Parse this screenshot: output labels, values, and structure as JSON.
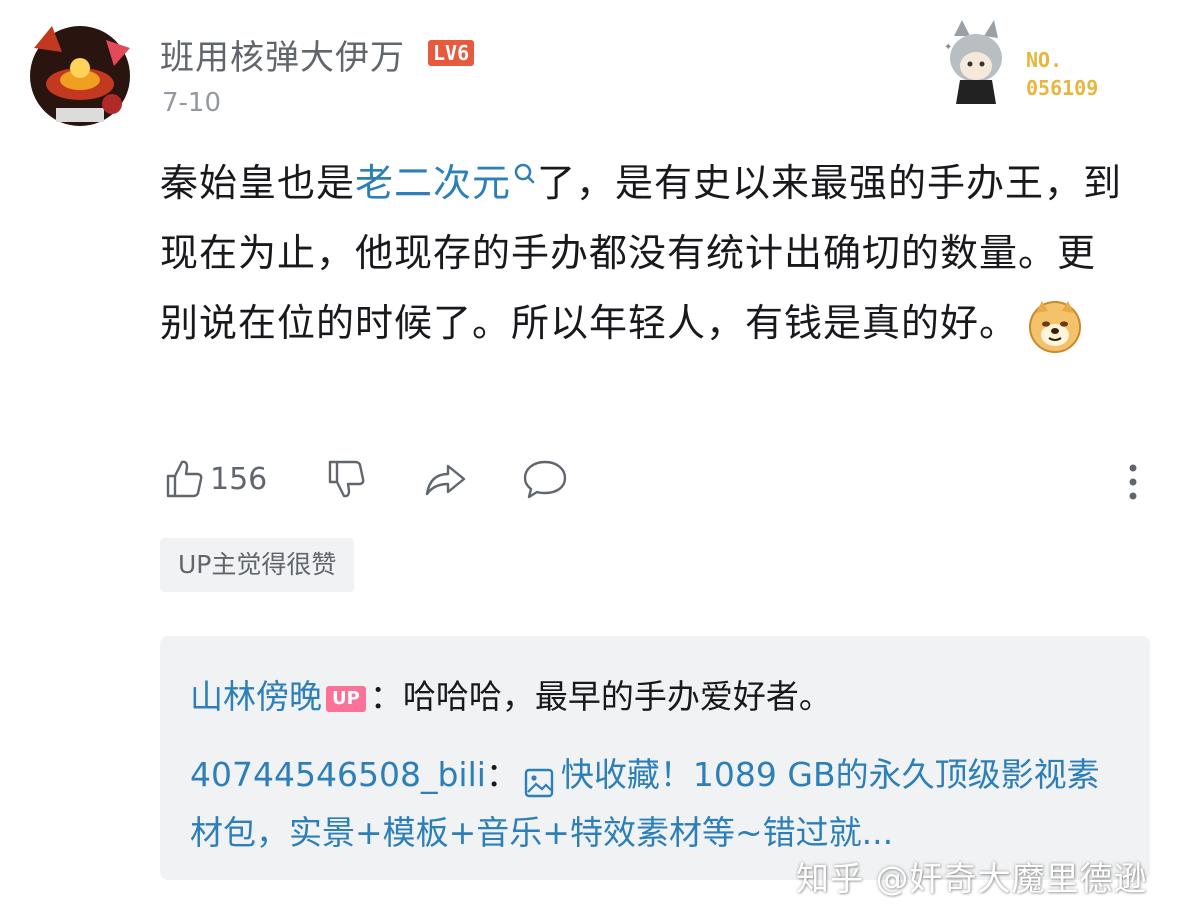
{
  "user": {
    "name": "班用核弹大伊万",
    "level": "LV6",
    "date": "7-10"
  },
  "fan_badge": {
    "line1": "NO.",
    "line2": "056109"
  },
  "comment": {
    "part1": "秦始皇也是",
    "keyword": "老二次元",
    "part2": "了，是有史以来最强的手办王，到现在为止，他现存的手办都没有统计出确切的数量。更别说在位的时候了。所以年轻人，有钱是真的好。",
    "emoji": "doge-emoji"
  },
  "actions": {
    "like_count": "156",
    "icons": [
      "thumbs-up-icon",
      "thumbs-down-icon",
      "share-icon",
      "reply-icon",
      "more-icon"
    ]
  },
  "up_tag": "UP主觉得很赞",
  "replies": [
    {
      "name": "山林傍晚",
      "badge": "UP",
      "sep": "：",
      "text": "哈哈哈，最早的手办爱好者。"
    },
    {
      "name": "40744546508_bili",
      "sep": "：",
      "text": "快收藏！1089 GB的永久顶级影视素材包，实景+模板+音乐+特效素材等~错过就..."
    }
  ],
  "watermark": "知乎 @奸奇大魔里德逊",
  "colors": {
    "link_blue": "#2d7fb8",
    "level_red": "#e85a3d",
    "up_pink": "#fb7299",
    "badge_gold": "#e8b63e",
    "reply_bg": "#f1f2f3"
  }
}
